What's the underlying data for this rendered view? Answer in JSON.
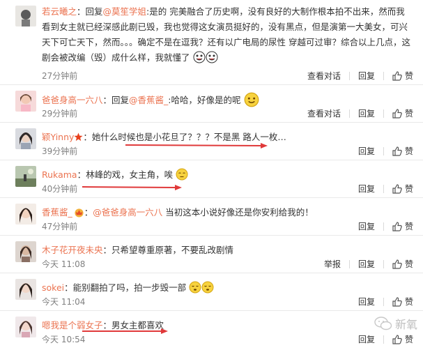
{
  "colors": {
    "accent": "#eb7350",
    "arrow": "#e0393a",
    "muted": "#808080"
  },
  "comments": [
    {
      "user": "若云曦之",
      "sep": "：回复",
      "mention": "@莫笙学姐",
      "text": ":是的 完美融合了历史啊，没有良好的大制作根本拍不出来，然而我看到女主就已经深感此剧已毁，我也觉得这女演员挺好的，没有黑点，但是演第一大美女，可兴天下可亡天下，然而。。。确定不是在逗我？还有以广电局的尿性 穿越可过审？综合以上几点，这剧会被改编（毁）成什么样，我就懂了",
      "time": "27分钟前",
      "actions": [
        "查看对话",
        "回复",
        "赞"
      ]
    },
    {
      "user": "爸爸身高一六八",
      "sep": "：回复",
      "mention": "@香蕉酱_",
      "text": ":哈哈，好像是的呢",
      "time": "29分钟前",
      "actions": [
        "查看对话",
        "回复",
        "赞"
      ]
    },
    {
      "user": "颖Yinny",
      "sep": "：",
      "mention": "",
      "text": "她什么时候也是小花旦了？？？不是黑 路人一枚…",
      "time": "39分钟前",
      "actions": [
        "回复",
        "赞"
      ]
    },
    {
      "user": "Rukama",
      "sep": "：",
      "mention": "",
      "text": "林峰的戏，女主角，唉",
      "time": "40分钟前",
      "actions": [
        "回复",
        "赞"
      ]
    },
    {
      "user": "香蕉酱_",
      "sep": "：",
      "mention": "@爸爸身高一六八",
      "text": "当初这本小说好像还是你安利给我的！",
      "time": "47分钟前",
      "actions": [
        "回复",
        "赞"
      ]
    },
    {
      "user": "木子花开夜未央",
      "sep": "：",
      "mention": "",
      "text": "只希望尊重原著，不要乱改剧情",
      "time": "今天 11:08",
      "actions": [
        "举报",
        "回复",
        "赞"
      ]
    },
    {
      "user": "sokei",
      "sep": "：",
      "mention": "",
      "text": "能别翻拍了吗，拍一步毁一部",
      "time": "今天 11:04",
      "actions": [
        "回复",
        "赞"
      ]
    },
    {
      "user": "嗯我是个弱女子",
      "sep": "：",
      "mention": "",
      "text": "男女主都喜欢",
      "time": "今天 10:54",
      "actions": [
        "回复",
        "赞"
      ]
    }
  ],
  "watermark": "新氧"
}
